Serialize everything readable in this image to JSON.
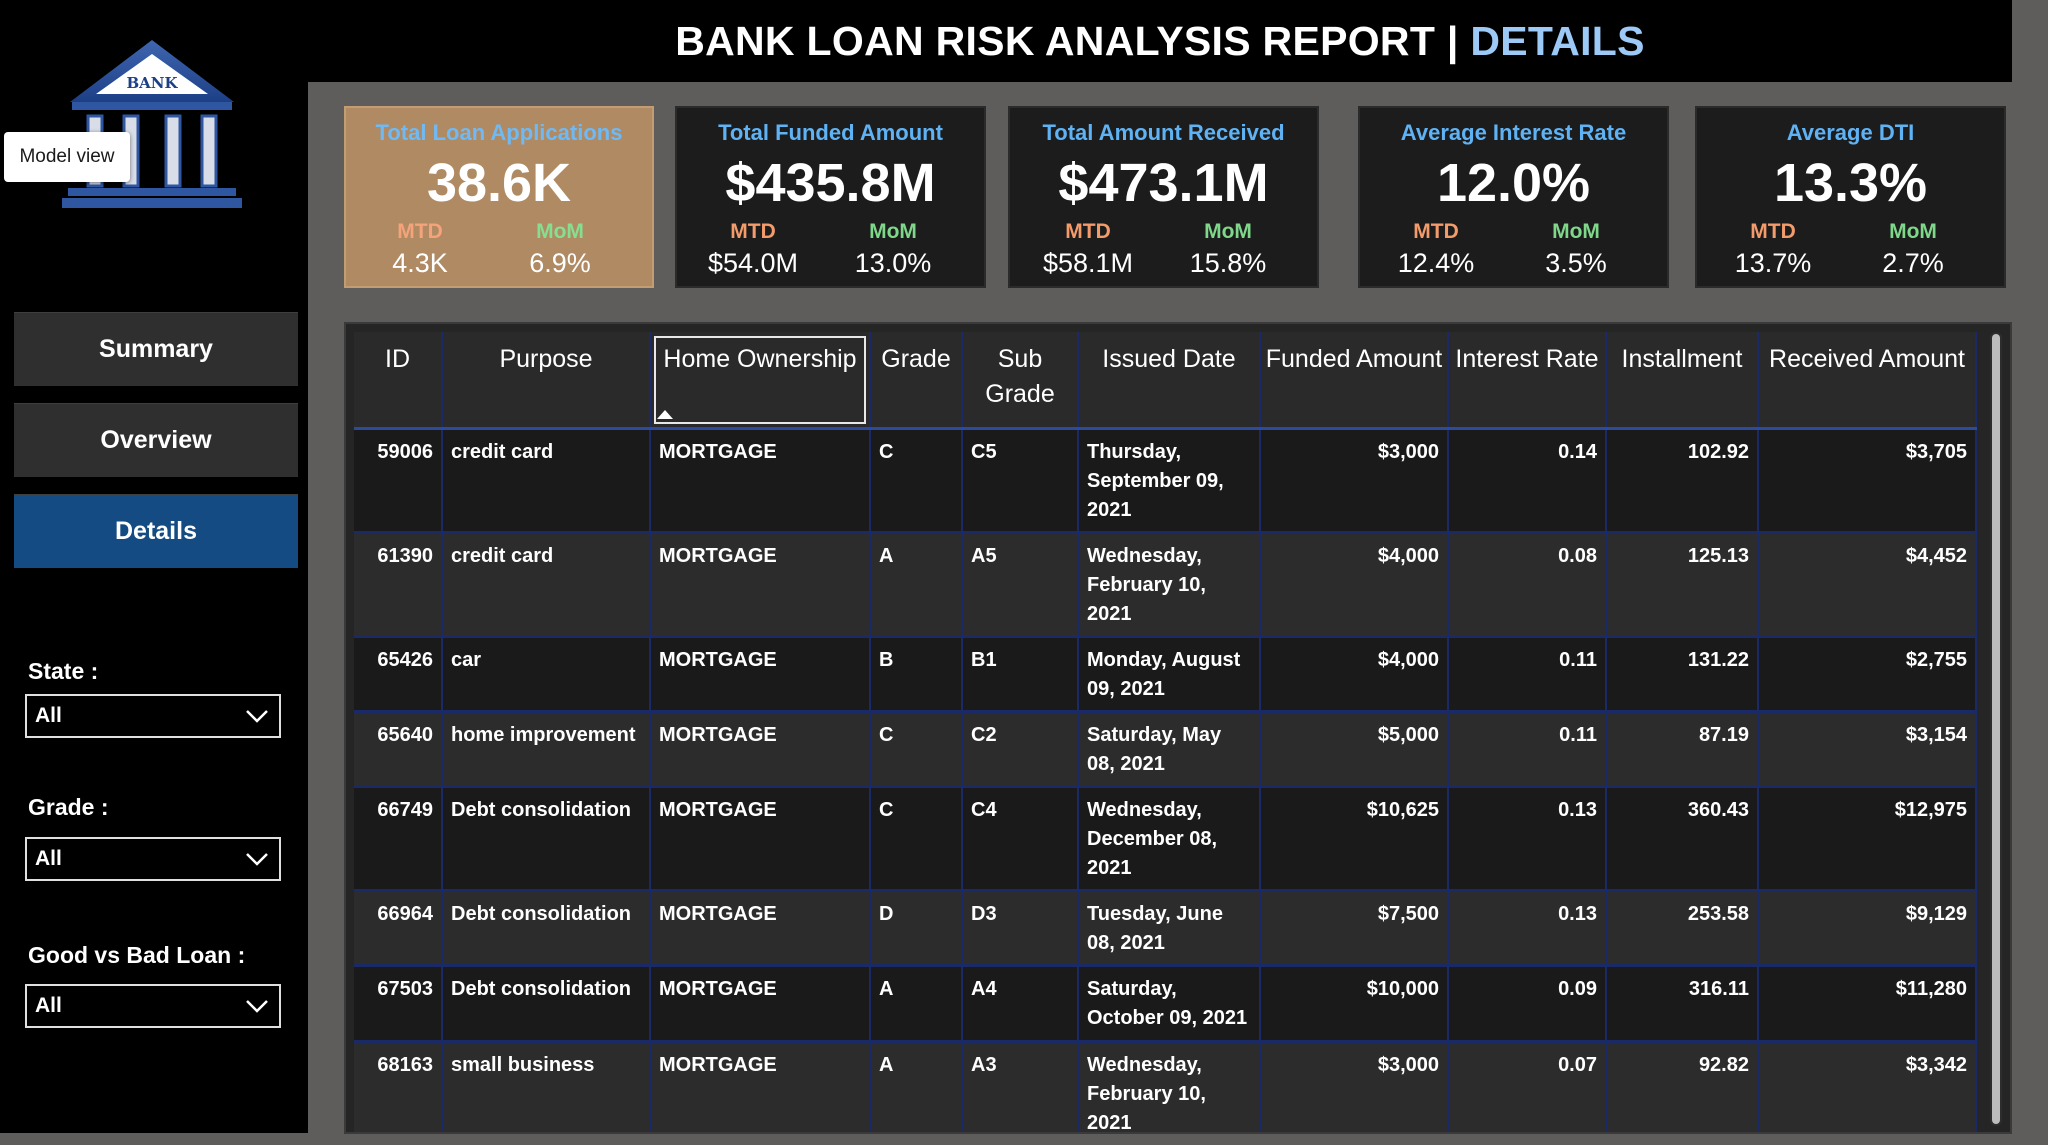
{
  "header": {
    "title_main": "BANK LOAN RISK ANALYSIS REPORT | ",
    "title_accent": "DETAILS"
  },
  "logo": {
    "text": "BANK"
  },
  "tooltip": {
    "text": "Model view"
  },
  "nav": [
    {
      "label": "Summary",
      "active": false
    },
    {
      "label": "Overview",
      "active": false
    },
    {
      "label": "Details",
      "active": true
    }
  ],
  "filters": {
    "state": {
      "label": "State :",
      "value": "All"
    },
    "grade": {
      "label": "Grade :",
      "value": "All"
    },
    "good_bad": {
      "label": "Good vs Bad Loan :",
      "value": "All"
    }
  },
  "kpis": [
    {
      "title": "Total Loan Applications",
      "value": "38.6K",
      "mtd_label": "MTD",
      "mtd": "4.3K",
      "mom_label": "MoM",
      "mom": "6.9%"
    },
    {
      "title": "Total Funded Amount",
      "value": "$435.8M",
      "mtd_label": "MTD",
      "mtd": "$54.0M",
      "mom_label": "MoM",
      "mom": "13.0%"
    },
    {
      "title": "Total Amount Received",
      "value": "$473.1M",
      "mtd_label": "MTD",
      "mtd": "$58.1M",
      "mom_label": "MoM",
      "mom": "15.8%"
    },
    {
      "title": "Average Interest Rate",
      "value": "12.0%",
      "mtd_label": "MTD",
      "mtd": "12.4%",
      "mom_label": "MoM",
      "mom": "3.5%"
    },
    {
      "title": "Average DTI",
      "value": "13.3%",
      "mtd_label": "MTD",
      "mtd": "13.7%",
      "mom_label": "MoM",
      "mom": "2.7%"
    }
  ],
  "table": {
    "columns": [
      "ID",
      "Purpose",
      "Home Ownership",
      "Grade",
      "Sub Grade",
      "Issued Date",
      "Funded Amount",
      "Interest Rate",
      "Installment",
      "Received Amount"
    ],
    "rows": [
      [
        "59006",
        "credit card",
        "MORTGAGE",
        "C",
        "C5",
        "Thursday, September 09, 2021",
        "$3,000",
        "0.14",
        "102.92",
        "$3,705"
      ],
      [
        "61390",
        "credit card",
        "MORTGAGE",
        "A",
        "A5",
        "Wednesday, February 10, 2021",
        "$4,000",
        "0.08",
        "125.13",
        "$4,452"
      ],
      [
        "65426",
        "car",
        "MORTGAGE",
        "B",
        "B1",
        "Monday, August 09, 2021",
        "$4,000",
        "0.11",
        "131.22",
        "$2,755"
      ],
      [
        "65640",
        "home improvement",
        "MORTGAGE",
        "C",
        "C2",
        "Saturday, May 08, 2021",
        "$5,000",
        "0.11",
        "87.19",
        "$3,154"
      ],
      [
        "66749",
        "Debt consolidation",
        "MORTGAGE",
        "C",
        "C4",
        "Wednesday, December 08, 2021",
        "$10,625",
        "0.13",
        "360.43",
        "$12,975"
      ],
      [
        "66964",
        "Debt consolidation",
        "MORTGAGE",
        "D",
        "D3",
        "Tuesday, June 08, 2021",
        "$7,500",
        "0.13",
        "253.58",
        "$9,129"
      ],
      [
        "67503",
        "Debt consolidation",
        "MORTGAGE",
        "A",
        "A4",
        "Saturday, October 09, 2021",
        "$10,000",
        "0.09",
        "316.11",
        "$11,280"
      ],
      [
        "68163",
        "small business",
        "MORTGAGE",
        "A",
        "A3",
        "Wednesday, February 10, 2021",
        "$3,000",
        "0.07",
        "92.82",
        "$3,342"
      ]
    ]
  },
  "colors": {
    "accent": "#9cc9f5",
    "kpi_title": "#5fb3f5",
    "mtd": "#f39b6a",
    "mom": "#7fd78a",
    "nav_active": "#134b82",
    "kpi_highlight": "#b08a63"
  }
}
